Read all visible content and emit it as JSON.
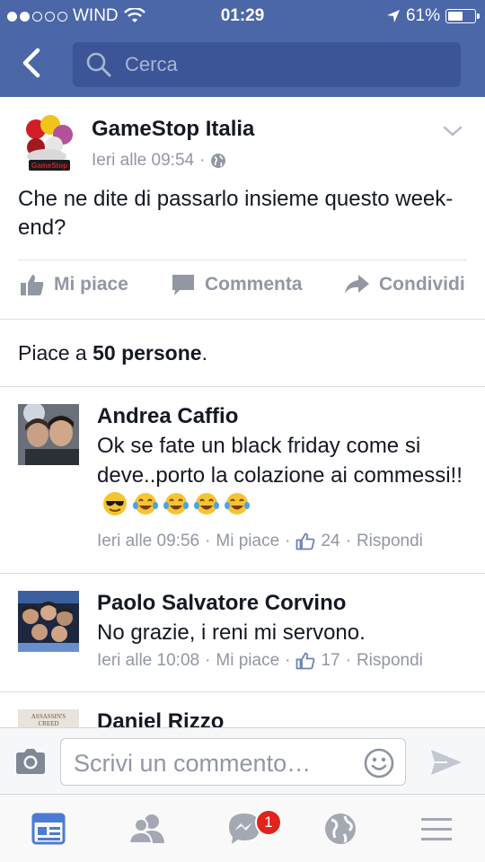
{
  "status_bar": {
    "carrier": "WIND",
    "time": "01:29",
    "battery": "61%",
    "battery_level": 0.61
  },
  "nav": {
    "search_placeholder": "Cerca"
  },
  "post": {
    "page_name": "GameStop Italia",
    "timestamp": "Ieri alle 09:54",
    "separator": "·",
    "text": "Che ne dite di passarlo insieme questo week-end?",
    "logo_lettering": "GameStop",
    "actions": {
      "like": "Mi piace",
      "comment": "Commenta",
      "share": "Condividi"
    }
  },
  "likes_summary": {
    "prefix": "Piace a ",
    "count": "50 persone",
    "suffix": "."
  },
  "comments": [
    {
      "name": "Andrea Caffio",
      "text": "Ok se fate un black friday come si deve..porto la colazione ai commessi!!",
      "emojis": [
        "sunglasses-emoji",
        "tears-of-joy-emoji",
        "tears-of-joy-emoji",
        "tears-of-joy-emoji",
        "tears-of-joy-emoji"
      ],
      "time": "Ieri alle 09:56",
      "like": "Mi piace",
      "likes": "24",
      "reply": "Rispondi"
    },
    {
      "name": "Paolo Salvatore Corvino",
      "text": "No grazie, i reni mi servono.",
      "time": "Ieri alle 10:08",
      "like": "Mi piace",
      "likes": "17",
      "reply": "Rispondi"
    },
    {
      "name": "Daniel Rizzo",
      "avatar_lettering": "ASSASSIN'S CREED"
    }
  ],
  "compose": {
    "placeholder": "Scrivi un commento…"
  },
  "tabbar": {
    "messages_badge": "1"
  },
  "colors": {
    "nav_blue": "#4b67a8",
    "search_bg": "#3b5596",
    "icon_gray": "#9197a3",
    "active_tab": "#4b7bd4",
    "badge_red": "#e0241b"
  }
}
